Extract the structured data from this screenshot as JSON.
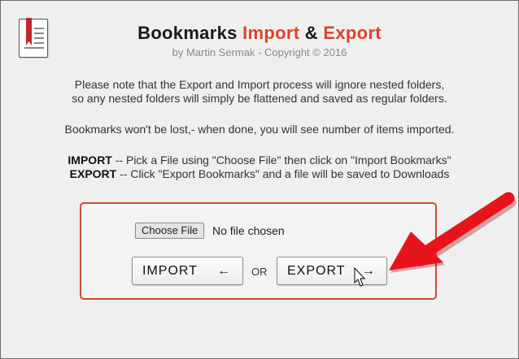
{
  "header": {
    "title_main": "Bookmarks",
    "title_accent_1": "Import",
    "title_amp": "&",
    "title_accent_2": "Export",
    "subtitle": "by Martin Sermak - Copyright © 2016"
  },
  "notes": {
    "line1": "Please note that the Export and Import process will ignore nested folders,",
    "line2": "so any nested folders will simply be flattened and saved as regular folders.",
    "line3": "Bookmarks won't be lost,- when done, you will see number of items imported.",
    "import_label": "IMPORT",
    "import_text": " -- Pick a File using \"Choose File\" then click on \"Import Bookmarks\"",
    "export_label": "EXPORT",
    "export_text": " -- Click \"Export Bookmarks\" and a file will be saved to Downloads"
  },
  "panel": {
    "choose_file_label": "Choose File",
    "no_file_text": "No file chosen",
    "import_button": "IMPORT",
    "import_arrow": "←",
    "or_text": "OR",
    "export_button": "EXPORT",
    "export_arrow": "→"
  },
  "colors": {
    "accent": "#d9452b",
    "panel_border": "#c94e33",
    "annotation_arrow": "#e8141c"
  },
  "icons": {
    "logo": "bookmark-book-icon",
    "cursor": "mouse-pointer-icon",
    "annotation": "red-arrow-icon"
  }
}
